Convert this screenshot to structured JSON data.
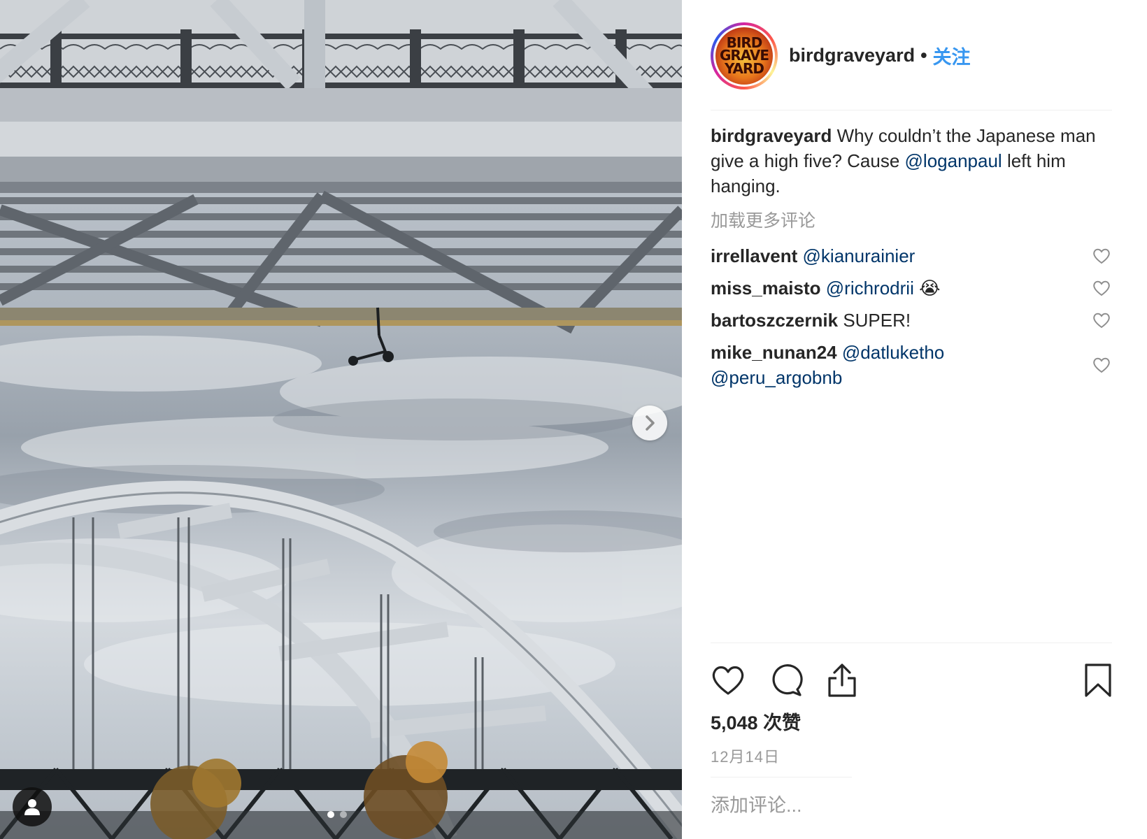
{
  "post": {
    "photo_alt": "Bridge with scooter hanging",
    "carousel_dots": 2,
    "active_dot": 0
  },
  "header": {
    "username": "birdgraveyard",
    "separator": "•",
    "follow_label": "关注",
    "avatar_text_lines": [
      "BIRD",
      "GRAVE",
      "YARD"
    ]
  },
  "caption": {
    "username": "birdgraveyard",
    "text_before": "Why couldn’t the Japanese man give a high five? Cause",
    "mention": "@loganpaul",
    "text_after": "left him hanging."
  },
  "load_more_label": "加载更多评论",
  "comments": [
    {
      "username": "irrellavent",
      "mentions": [
        "@kianurainier"
      ],
      "text": ""
    },
    {
      "username": "miss_maisto",
      "mentions": [
        "@richrodrii"
      ],
      "text": "😭"
    },
    {
      "username": "bartoszczernik",
      "mentions": [],
      "text": "SUPER!"
    },
    {
      "username": "mike_nunan24",
      "mentions": [
        "@datluketho",
        "@peru_argobnb"
      ],
      "text": ""
    }
  ],
  "likes_label": "5,048 次赞",
  "date_label": "12月14日",
  "add_comment_placeholder": "添加评论...",
  "colors": {
    "link": "#003569",
    "follow": "#3897f0",
    "muted": "#999999",
    "text": "#262626"
  },
  "icons": [
    "heart-icon",
    "comment-icon",
    "share-icon",
    "bookmark-icon",
    "chevron-right-icon",
    "user-tag-icon"
  ]
}
